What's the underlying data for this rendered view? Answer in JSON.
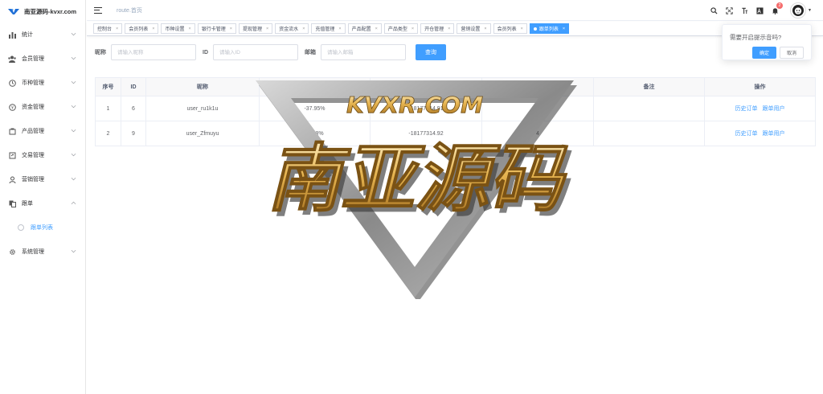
{
  "app": {
    "logo_text": "南亚源码-kvxr.com"
  },
  "sidebar": {
    "items": [
      {
        "label": "统计",
        "icon": "chart-icon"
      },
      {
        "label": "会员管理",
        "icon": "users-icon"
      },
      {
        "label": "币种管理",
        "icon": "coin-icon"
      },
      {
        "label": "资金管理",
        "icon": "money-icon"
      },
      {
        "label": "产品管理",
        "icon": "product-icon"
      },
      {
        "label": "交易管理",
        "icon": "trade-icon"
      },
      {
        "label": "营销管理",
        "icon": "marketing-icon"
      },
      {
        "label": "跟单",
        "icon": "copy-icon",
        "expanded": true
      },
      {
        "label": "系统管理",
        "icon": "gear-icon"
      }
    ],
    "sub_item": {
      "label": "跟单列表"
    }
  },
  "header": {
    "breadcrumb": "route.首页",
    "notification_count": "2"
  },
  "tags": [
    {
      "label": "控制台",
      "active": false
    },
    {
      "label": "会员列表",
      "active": false
    },
    {
      "label": "币种设置",
      "active": false
    },
    {
      "label": "银行卡管理",
      "active": false
    },
    {
      "label": "提现管理",
      "active": false
    },
    {
      "label": "资金流水",
      "active": false
    },
    {
      "label": "充值管理",
      "active": false
    },
    {
      "label": "产品配置",
      "active": false
    },
    {
      "label": "产品类型",
      "active": false
    },
    {
      "label": "开仓管理",
      "active": false
    },
    {
      "label": "营销设置",
      "active": false
    },
    {
      "label": "会员列表",
      "active": false
    },
    {
      "label": "跟单列表",
      "active": true
    }
  ],
  "filter": {
    "nickname_label": "昵称",
    "nickname_placeholder": "请输入昵称",
    "id_label": "ID",
    "id_placeholder": "请输入ID",
    "email_label": "邮箱",
    "email_placeholder": "请输入邮箱",
    "search_label": "查询"
  },
  "table": {
    "columns": [
      "序号",
      "ID",
      "昵称",
      "收益",
      "总收益",
      "跟单用户",
      "备注",
      "操作"
    ],
    "rows": [
      {
        "index": "1",
        "id": "6",
        "nickname": "user_ru1k1u",
        "profit": "-37.95%",
        "total": "-18177314.91",
        "followers": "",
        "remark": ""
      },
      {
        "index": "2",
        "id": "9",
        "nickname": "user_Zfmuyu",
        "profit": "-37.8%",
        "total": "-18177314.92",
        "followers": "4",
        "remark": ""
      }
    ],
    "op_history": "历史订单",
    "op_followers": "跟单用户"
  },
  "popover": {
    "text": "需要开启提示音吗?",
    "confirm": "确定",
    "cancel": "取消"
  },
  "watermark": {
    "url_text": "KVXR.COM",
    "main_text": "南亚源码"
  },
  "colors": {
    "primary": "#409eff",
    "badge": "#f56c6c",
    "watermark_gold": "#e6b450"
  }
}
